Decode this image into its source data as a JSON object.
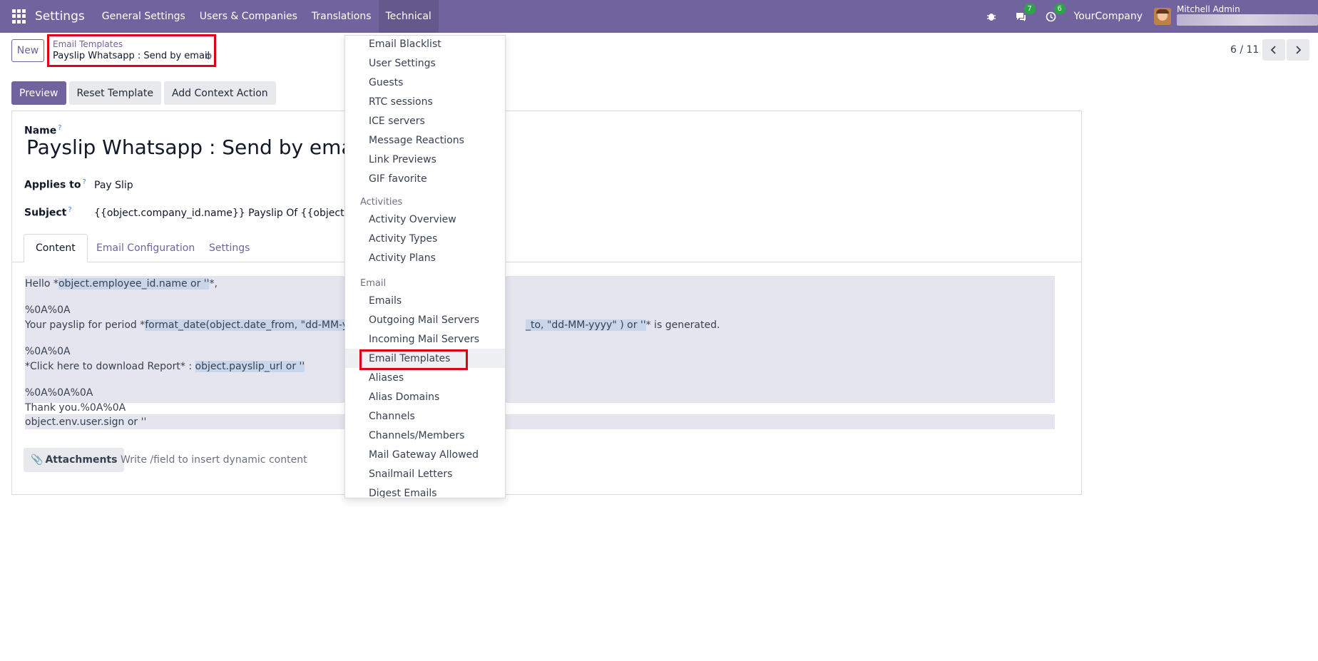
{
  "topbar": {
    "app_title": "Settings",
    "menus": [
      "General Settings",
      "Users & Companies",
      "Translations",
      "Technical"
    ],
    "chat_count": "7",
    "activity_count": "6",
    "company": "YourCompany",
    "user_name": "Mitchell Admin"
  },
  "control": {
    "new_label": "New",
    "breadcrumb_parent": "Email Templates",
    "breadcrumb_current": "Payslip Whatsapp : Send by email",
    "pager": "6 / 11"
  },
  "actions": {
    "preview": "Preview",
    "reset": "Reset Template",
    "add_context": "Add Context Action"
  },
  "form": {
    "name_label": "Name",
    "name_value": "Payslip Whatsapp : Send by email",
    "applies_label": "Applies to",
    "applies_value": "Pay Slip",
    "subject_label": "Subject",
    "subject_value": "{{object.company_id.name}} Payslip Of {{object.name or",
    "help_mark": "?",
    "tabs": [
      "Content",
      "Email Configuration",
      "Settings"
    ],
    "body": {
      "l1a": "Hello *",
      "l1b": "object.employee_id.name or ''",
      "l1c": "*,",
      "l2": "%0A%0A",
      "l3a": "Your payslip for period *",
      "l3b": "format_date(object.date_from, \"dd-MM-yyyy\"",
      "l3c": "_to, \"dd-MM-yyyy\" ) or ''",
      "l3d": "* is generated.",
      "l4": "%0A%0A",
      "l5a": "*Click here to download Report* : ",
      "l5b": "object.payslip_url or ''",
      "l6": "%0A%0A%0A",
      "l7": "Thank you.%0A%0A",
      "l8": "object.env.user.sign or ''"
    },
    "attachments": "Attachments",
    "placeholder": "Write /field to insert dynamic content"
  },
  "dropdown": {
    "items_top": [
      "Email Blacklist",
      "User Settings",
      "Guests",
      "RTC sessions",
      "ICE servers",
      "Message Reactions",
      "Link Previews",
      "GIF favorite"
    ],
    "header_activities": "Activities",
    "items_activities": [
      "Activity Overview",
      "Activity Types",
      "Activity Plans"
    ],
    "header_email": "Email",
    "items_email": [
      "Emails",
      "Outgoing Mail Servers",
      "Incoming Mail Servers",
      "Email Templates",
      "Aliases",
      "Alias Domains",
      "Channels",
      "Channels/Members",
      "Mail Gateway Allowed",
      "Snailmail Letters",
      "Digest Emails"
    ]
  }
}
